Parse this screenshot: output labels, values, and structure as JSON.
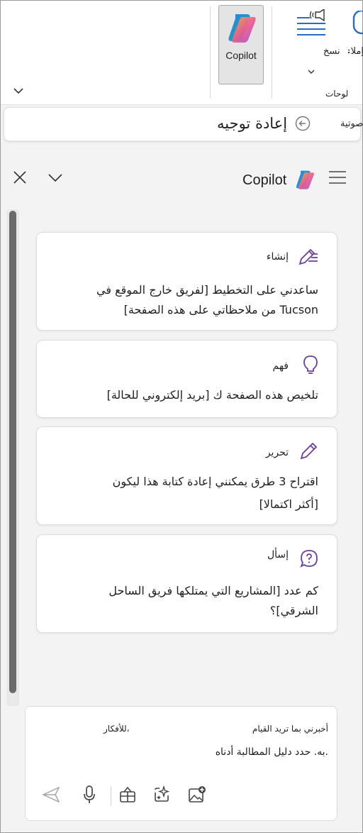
{
  "ribbon": {
    "copilot_label": "Copilot",
    "transcribe_label": "نسخ",
    "partial_label": "إملاء",
    "group_label": "لوحات"
  },
  "command_bar": {
    "redirect_label": "إعادة توجيه",
    "voice_label": "صوتية"
  },
  "pane": {
    "title": "Copilot"
  },
  "cards": [
    {
      "category": "إنشاء",
      "icon": "pen-lines-icon",
      "line1": "ساعدني على التخطيط [لفريق خارج الموقع في",
      "line2": "Tucson من ملاحظاتي على هذه الصفحة]"
    },
    {
      "category": "فهم",
      "icon": "lightbulb-icon",
      "line1": "تلخيص هذه الصفحة ك [بريد إلكتروني للحالة]",
      "line2": ""
    },
    {
      "category": "تحرير",
      "icon": "pencil-icon",
      "line1": "اقتراح 3 طرق يمكنني إعادة كتابة هذا ليكون",
      "line2": "[أكثر اكتمالا]"
    },
    {
      "category": "إسأل",
      "icon": "question-bubble-icon",
      "line1": "كم عدد [المشاريع التي يمتلكها فريق الساحل",
      "line2": "الشرقي]؟"
    }
  ],
  "compose": {
    "placeholder_a": "أخبرني بما تريد القيام",
    "placeholder_b": "للأفكار،",
    "placeholder_c": "به. حدد دليل المطالبة أدناه."
  },
  "colors": {
    "accent_purple": "#6b3fa0",
    "icon_gray": "#555555"
  }
}
